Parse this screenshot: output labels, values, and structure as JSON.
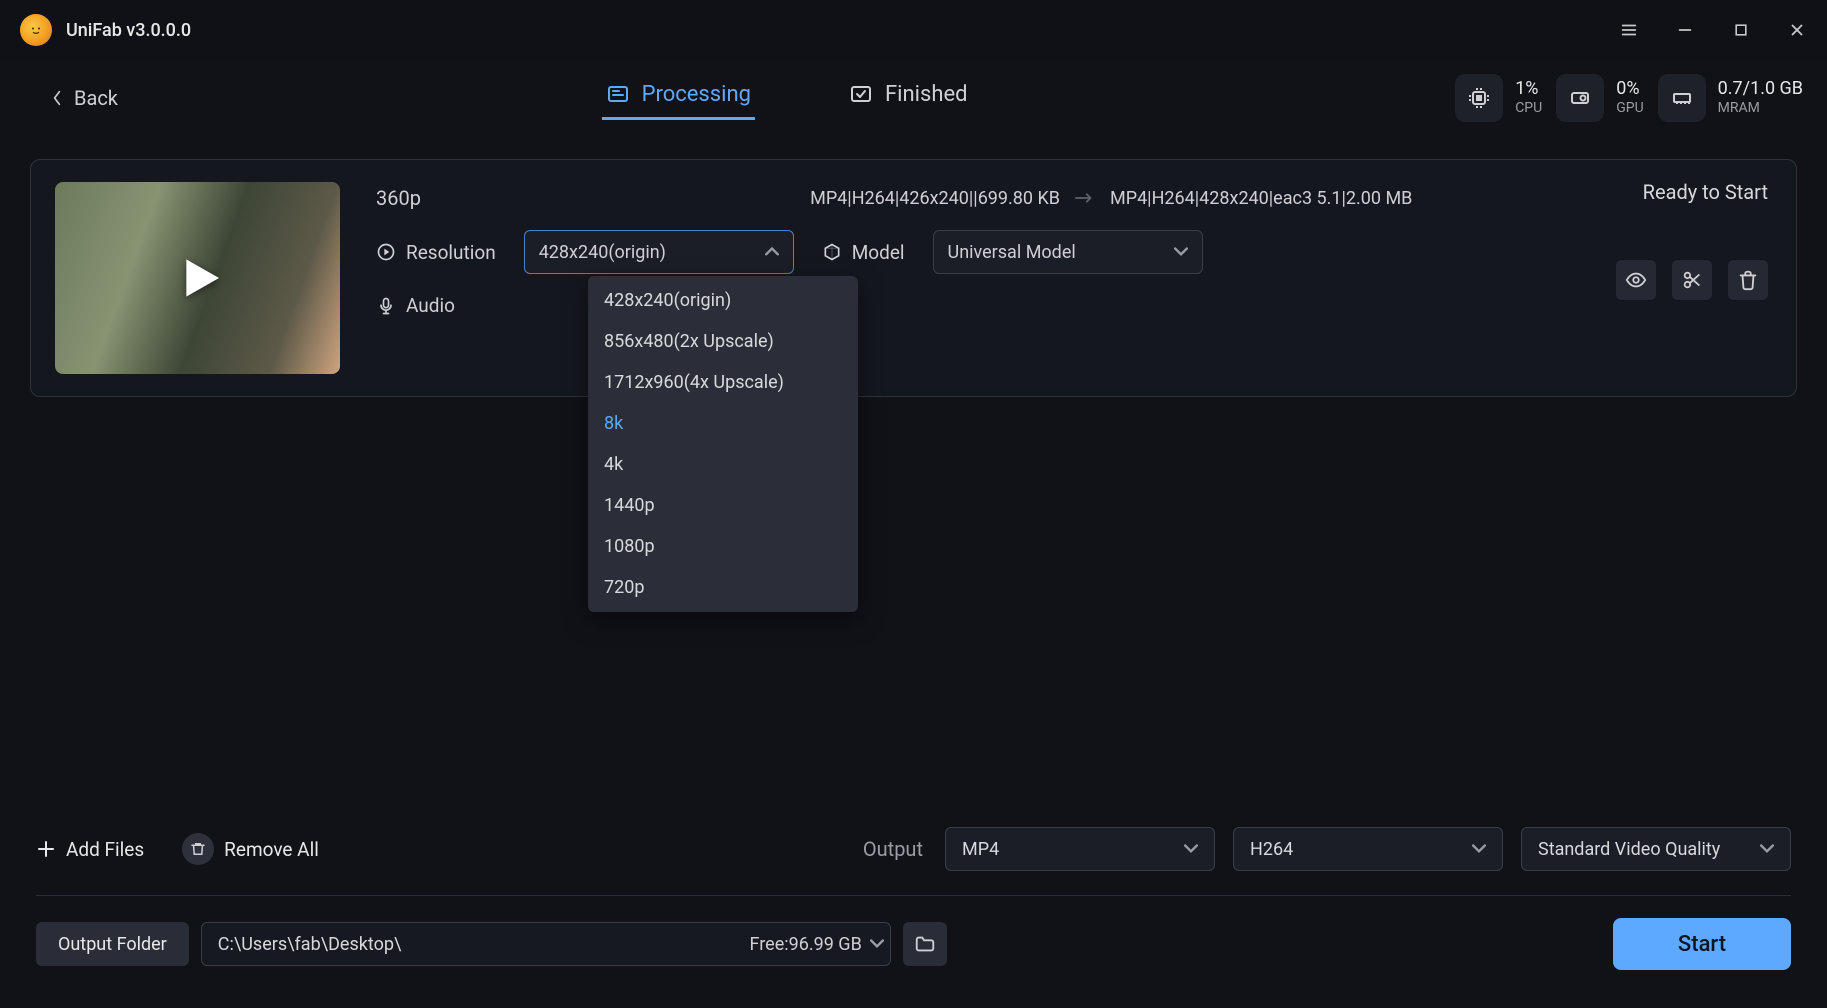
{
  "app": {
    "title": "UniFab v3.0.0.0"
  },
  "topbar": {
    "back": "Back",
    "tabs": {
      "processing": "Processing",
      "finished": "Finished"
    },
    "stats": {
      "cpu": {
        "value": "1%",
        "label": "CPU"
      },
      "gpu": {
        "value": "0%",
        "label": "GPU"
      },
      "mram": {
        "value": "0.7/1.0 GB",
        "label": "MRAM"
      }
    }
  },
  "file": {
    "source_quality": "360p",
    "source_info": "MP4|H264|426x240||699.80 KB",
    "target_info": "MP4|H264|428x240|eac3 5.1|2.00 MB",
    "status": "Ready to Start",
    "resolution_label": "Resolution",
    "resolution_selected": "428x240(origin)",
    "resolution_options": [
      "428x240(origin)",
      "856x480(2x Upscale)",
      "1712x960(4x Upscale)",
      "8k",
      "4k",
      "1440p",
      "1080p",
      "720p"
    ],
    "resolution_highlighted": "8k",
    "model_label": "Model",
    "model_selected": "Universal Model",
    "audio_label": "Audio"
  },
  "bottom": {
    "add_files": "Add Files",
    "remove_all": "Remove All",
    "output_label": "Output",
    "format_selected": "MP4",
    "codec_selected": "H264",
    "quality_selected": "Standard Video Quality"
  },
  "footer": {
    "output_folder_label": "Output Folder",
    "path": "C:\\Users\\fab\\Desktop\\",
    "free_space": "Free:96.99 GB",
    "start": "Start"
  }
}
